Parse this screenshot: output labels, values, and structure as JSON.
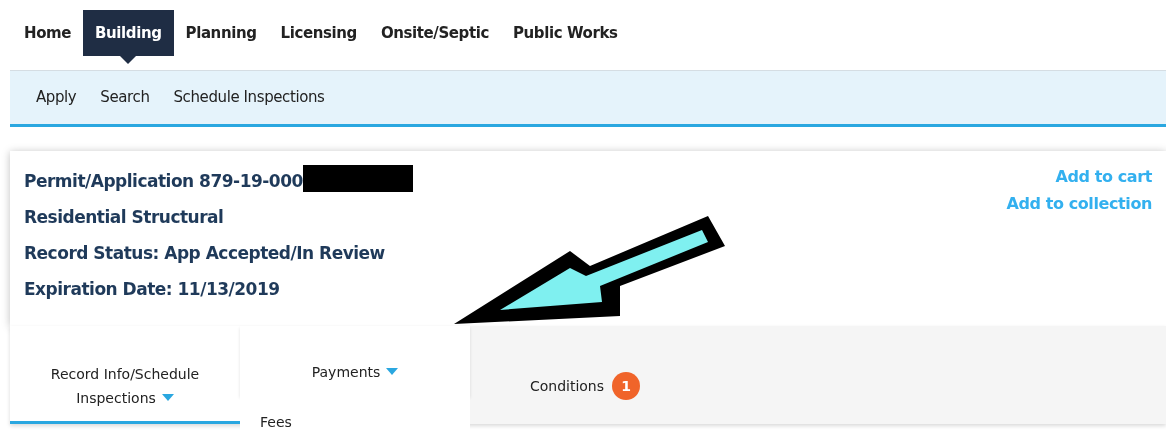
{
  "main_nav": [
    {
      "label": "Home",
      "selected": false
    },
    {
      "label": "Building",
      "selected": true
    },
    {
      "label": "Planning",
      "selected": false
    },
    {
      "label": "Licensing",
      "selected": false
    },
    {
      "label": "Onsite/Septic",
      "selected": false
    },
    {
      "label": "Public Works",
      "selected": false
    }
  ],
  "sub_nav": [
    "Apply",
    "Search",
    "Schedule Inspections"
  ],
  "record": {
    "title": "Permit/Application 879-19-000",
    "redacted": true,
    "lines": [
      "Residential Structural",
      "Record Status: App Accepted/In Review",
      "Expiration Date: 11/13/2019"
    ],
    "actions": [
      "Add to cart",
      "Add to collection"
    ]
  },
  "tabs": [
    {
      "label": "Record Info/Schedule Inspections",
      "selected": true,
      "dropdown": true,
      "expanded": false
    },
    {
      "label": "Payments",
      "selected": false,
      "dropdown": true,
      "expanded": true,
      "menu": [
        "Fees"
      ]
    },
    {
      "label": "Conditions",
      "selected": false,
      "dropdown": false,
      "expanded": false,
      "count": "1"
    }
  ],
  "annotation": {
    "arrow": true
  }
}
